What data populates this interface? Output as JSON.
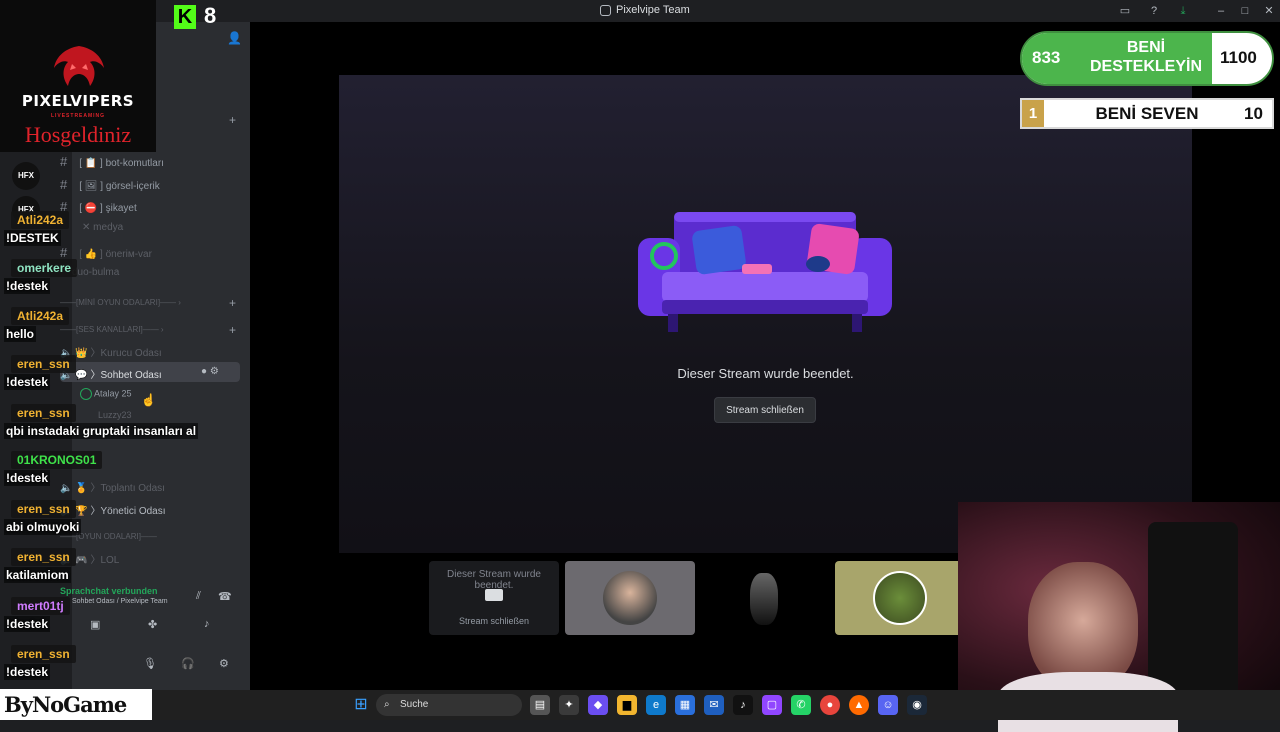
{
  "window": {
    "title": "Pixelvipe Team"
  },
  "brand": {
    "logo_title": "PIXELVIPERS",
    "logo_sub": "LIVESTREAMING",
    "logo_greeting": "Hosgeldiniz"
  },
  "kick": {
    "letter": "K",
    "viewers": "8"
  },
  "channels": [
    {
      "name": "bot-komutları",
      "emoji": "📋",
      "muted": false
    },
    {
      "name": "görsel-içerik",
      "emoji": "🖼",
      "muted": false
    },
    {
      "name": "şikayet",
      "emoji": "⛔",
      "muted": false
    },
    {
      "name": "medya",
      "emoji": "",
      "muted": true
    },
    {
      "name": "öneriм-var",
      "emoji": "👍",
      "muted": true
    },
    {
      "name": "duo-bulma",
      "emoji": "",
      "muted": true
    }
  ],
  "categories": {
    "mini_games": "MİNİ OYUN ODALARI",
    "voice": "SES KANALLARI",
    "games": "OYUN ODALARI"
  },
  "voice_channels": {
    "founder": "Kurucu Odası",
    "chat": "Sohbet Odası",
    "meeting": "Toplantı Odası",
    "admin": "Yönetici Odası",
    "lol": "LOL"
  },
  "voice_users": {
    "user1": "Atalay 25",
    "user2": "Luzzy23"
  },
  "voice_status": {
    "connected": "Sprachchat verbunden",
    "location": "Sohbet Odası / Pixelvipe Team"
  },
  "chat": [
    {
      "user": "Atli242a",
      "color": "#f0b232",
      "msg": "!DESTEK"
    },
    {
      "user": "omerkere",
      "color": "#8fe3c1",
      "msg": "!destek"
    },
    {
      "user": "Atli242a",
      "color": "#f0b232",
      "msg": "hello"
    },
    {
      "user": "eren_ssn",
      "color": "#f0b232",
      "msg": "!destek"
    },
    {
      "user": "eren_ssn",
      "color": "#f0b232",
      "msg": "qbi instadaki gruptaki insanları al"
    },
    {
      "user": "01KRONOS01",
      "color": "#3fe24a",
      "msg": "!destek"
    },
    {
      "user": "eren_ssn",
      "color": "#f0b232",
      "msg": "abi olmuyoki"
    },
    {
      "user": "eren_ssn",
      "color": "#f0b232",
      "msg": "katilamiom"
    },
    {
      "user": "mert01tj",
      "color": "#d07cff",
      "msg": "!destek"
    },
    {
      "user": "eren_ssn",
      "color": "#f0b232",
      "msg": "!destek"
    }
  ],
  "stream": {
    "ended": "Dieser Stream wurde beendet.",
    "close": "Stream schließen"
  },
  "tile_ended": {
    "text": "Dieser Stream wurde beendet.",
    "close": "Stream schließen"
  },
  "hud": {
    "left_count": "833",
    "label_top": "BENİ DESTEKLEYİN",
    "right_count": "1100",
    "rank": "1",
    "label_bottom": "BENİ SEVEN",
    "bottom_count": "10"
  },
  "taskbar": {
    "search_placeholder": "Suche"
  },
  "sponsor": {
    "name": "ByNoGame"
  },
  "colors": {
    "kick_green": "#53fc18",
    "hud_green": "#4cb54c",
    "gold": "#c9a24a"
  }
}
